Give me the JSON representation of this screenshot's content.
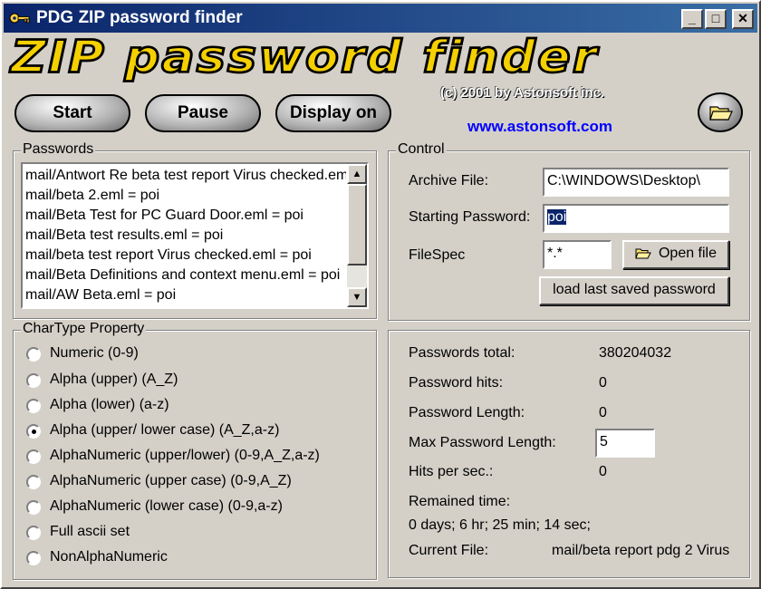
{
  "window": {
    "title": "PDG ZIP password finder",
    "controls": {
      "minimize": "_",
      "maximize": "□",
      "close": "✕"
    }
  },
  "header": {
    "banner_text": "ZIP password finder",
    "copyright": "(c) 2001 by Astonsoft inc.",
    "website": "www.astonsoft.com",
    "buttons": {
      "start": "Start",
      "pause": "Pause",
      "display": "Display on"
    }
  },
  "passwords": {
    "group_label": "Passwords",
    "items": [
      "mail/Antwort Re beta test report Virus checked.eml = poi",
      "mail/beta 2.eml = poi",
      "mail/Beta Test for PC Guard Door.eml = poi",
      "mail/Beta test results.eml = poi",
      "mail/beta test report Virus checked.eml = poi",
      "mail/Beta Definitions and context menu.eml = poi",
      "mail/AW Beta.eml = poi"
    ]
  },
  "chartype": {
    "group_label": "CharType Property",
    "options": [
      "Numeric (0-9)",
      "Alpha (upper) (A_Z)",
      "Alpha (lower) (a-z)",
      "Alpha (upper/ lower case) (A_Z,a-z)",
      "AlphaNumeric (upper/lower) (0-9,A_Z,a-z)",
      "AlphaNumeric (upper case) (0-9,A_Z)",
      "AlphaNumeric (lower case) (0-9,a-z)",
      "Full ascii set",
      "NonAlphaNumeric"
    ],
    "selected": "Alpha (upper/ lower case) (A_Z,a-z)"
  },
  "control": {
    "group_label": "Control",
    "archive_label": "Archive File:",
    "archive_value": "C:\\WINDOWS\\Desktop\\",
    "start_pw_label": "Starting Password:",
    "start_pw_value": "poi",
    "filespec_label": "FileSpec",
    "filespec_value": "*.*",
    "open_file_label": "Open file",
    "load_last_label": "load last saved password"
  },
  "stats": {
    "total_label": "Passwords total:",
    "total_value": "380204032",
    "hits_label": "Password hits:",
    "hits_value": "0",
    "length_label": "Password Length:",
    "length_value": "0",
    "max_length_label": "Max Password Length:",
    "max_length_value": "5",
    "hps_label": "Hits per sec.:",
    "hps_value": "0",
    "remained_label": "Remained time:",
    "remained_value": "0 days; 6 hr; 25 min; 14 sec;",
    "current_file_label": "Current File:",
    "current_file_value": "mail/beta report pdg 2 Virus"
  },
  "colors": {
    "face": "#d4d0c8",
    "title_blue": "#0a246a",
    "banner_yellow": "#f5d000",
    "link_blue": "#0000ff"
  }
}
